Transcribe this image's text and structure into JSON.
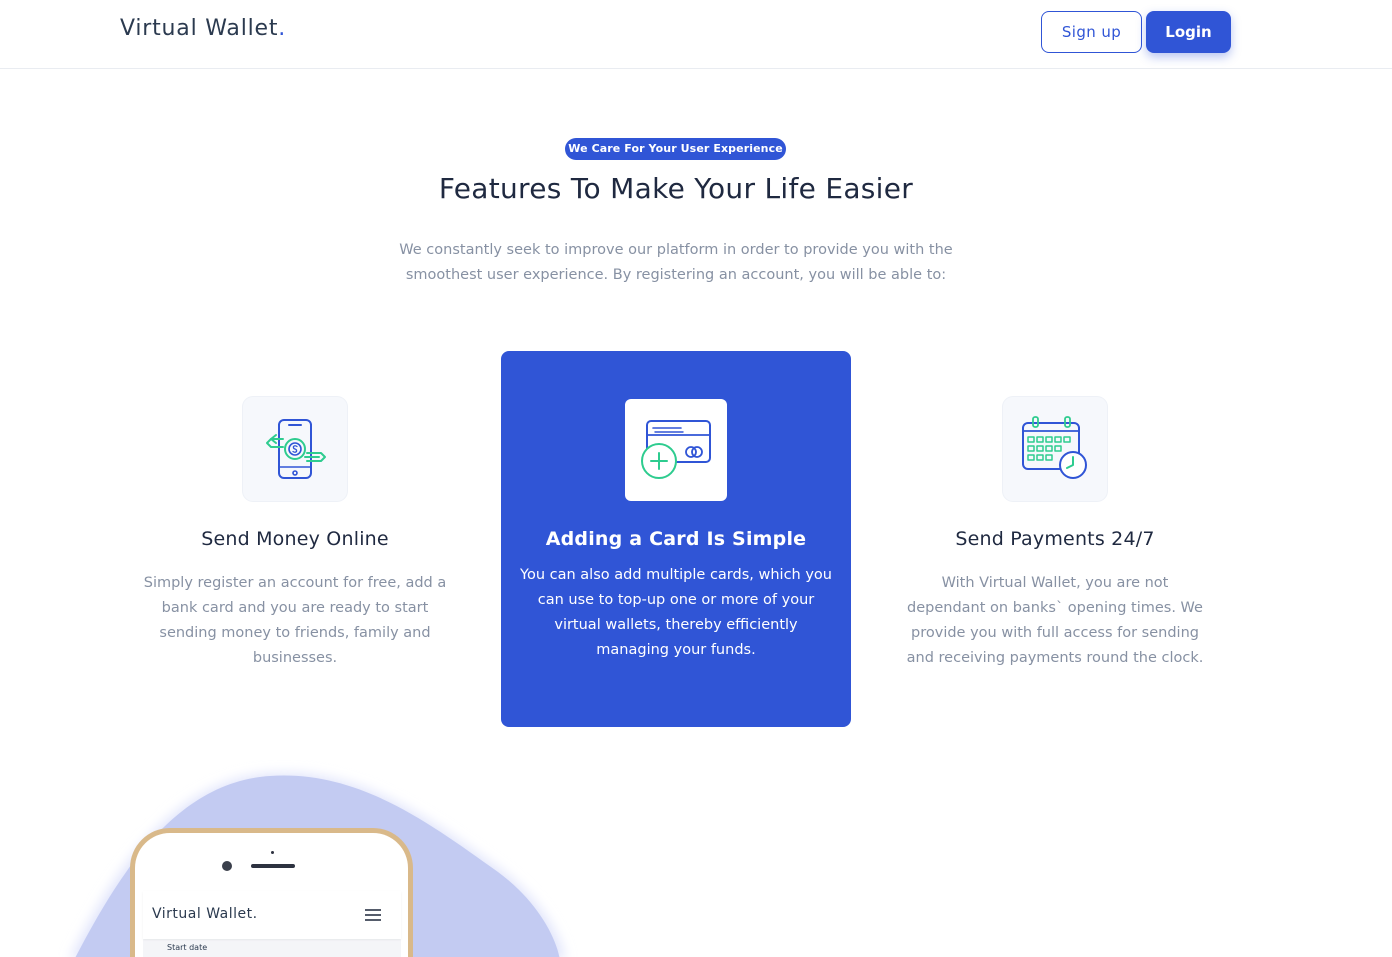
{
  "nav": {
    "brand": "Virtual Wallet",
    "brand_dot": ".",
    "signup_label": "Sign up",
    "login_label": "Login"
  },
  "hero": {
    "badge": "We Care For Your User Experience",
    "title": "Features To Make Your Life Easier",
    "lead": "We constantly seek to improve our platform in order to provide you with the smoothest user experience. By registering an account, you will be able to:"
  },
  "features": [
    {
      "icon": "phone-money-transfer-icon",
      "title": "Send Money Online",
      "text": "Simply register an account for free, add a bank card and you are ready to start sending money to friends, family and businesses."
    },
    {
      "icon": "add-card-icon",
      "title": "Adding a Card Is Simple",
      "text": "You can also add multiple cards, which you can use to top-up one or more of your virtual wallets, thereby efficiently managing your funds."
    },
    {
      "icon": "calendar-clock-icon",
      "title": "Send Payments 24/7",
      "text": "With Virtual Wallet, you are not dependant on banks` opening times. We provide you with full access for sending and receiving payments round the clock."
    }
  ],
  "phone_mockup": {
    "brand": "Virtual Wallet.",
    "field_label": "Start date"
  },
  "colors": {
    "primary": "#3055d6",
    "accent_green": "#2ecc8f",
    "text_dark": "#1f2940",
    "text_muted": "#8791a3",
    "blob": "#c3cbf2"
  }
}
